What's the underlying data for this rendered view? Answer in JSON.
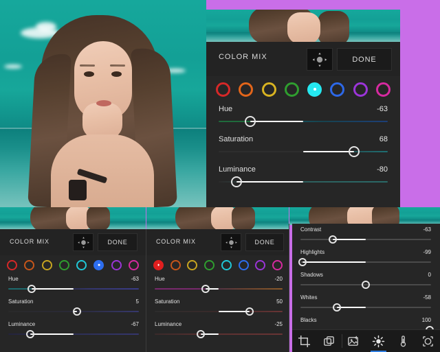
{
  "app": {
    "background_accent": "#c96ee8",
    "panel_bg": "#262626"
  },
  "main_panel": {
    "title": "COLOR MIX",
    "target_button_label": "target-select",
    "done_label": "DONE",
    "swatches": [
      {
        "name": "red",
        "color": "#d62828",
        "selected": false
      },
      {
        "name": "orange",
        "color": "#e2651a",
        "selected": false
      },
      {
        "name": "yellow",
        "color": "#d8b321",
        "selected": false
      },
      {
        "name": "green",
        "color": "#2f9e2f",
        "selected": false
      },
      {
        "name": "aqua",
        "color": "#25e8f0",
        "selected": true
      },
      {
        "name": "blue",
        "color": "#2d68e8",
        "selected": false
      },
      {
        "name": "purple",
        "color": "#9b35d8",
        "selected": false
      },
      {
        "name": "magenta",
        "color": "#d62aa0",
        "selected": false
      }
    ],
    "sliders": [
      {
        "label": "Hue",
        "value": "-63",
        "pct": 18.5,
        "track": "linear-gradient(90deg,#1f6b3c 0%, #1f6b3c 22%, #17525c 45%, #17424f 62%, #1d3f78 100%)"
      },
      {
        "label": "Saturation",
        "value": "68",
        "pct": 80.0,
        "track": "linear-gradient(90deg,#2e2e2e 0%, #2e2e2e 50%, #1e6f73 100%)"
      },
      {
        "label": "Luminance",
        "value": "-80",
        "pct": 10.5,
        "track": "linear-gradient(90deg,#2b2b2b 0%, #2f5e5c 40%, #2a6a68 100%)"
      }
    ]
  },
  "bottom_left_panel": {
    "title": "COLOR MIX",
    "done_label": "DONE",
    "swatches": [
      {
        "name": "red",
        "color": "#d62828",
        "selected": false
      },
      {
        "name": "orange",
        "color": "#c7561a",
        "selected": false
      },
      {
        "name": "yellow",
        "color": "#c8a520",
        "selected": false
      },
      {
        "name": "green",
        "color": "#2f9e2f",
        "selected": false
      },
      {
        "name": "aqua",
        "color": "#20c8d8",
        "selected": false
      },
      {
        "name": "blue",
        "color": "#2d6ef0",
        "selected": true
      },
      {
        "name": "purple",
        "color": "#9b35d8",
        "selected": false
      },
      {
        "name": "magenta",
        "color": "#d62aa0",
        "selected": false
      }
    ],
    "sliders": [
      {
        "label": "Hue",
        "value": "-63",
        "pct": 18.0,
        "track": "linear-gradient(90deg,#1d6a6e 0%, #1d6a6e 14%, #2a2a3a 38%, #34366e 62%, #3a3c88 100%)"
      },
      {
        "label": "Saturation",
        "value": "5",
        "pct": 52.5,
        "track": "linear-gradient(90deg,#2a2a2a 0%, #2a2a38 50%, #36386e 100%)"
      },
      {
        "label": "Luminance",
        "value": "-67",
        "pct": 17.0,
        "track": "linear-gradient(90deg,#24243c 0%, #2c2e52 45%, #34366e 100%)"
      }
    ]
  },
  "bottom_middle_panel": {
    "title": "COLOR MIX",
    "done_label": "DONE",
    "swatches": [
      {
        "name": "red",
        "color": "#e01f1f",
        "selected": true
      },
      {
        "name": "orange",
        "color": "#c7561a",
        "selected": false
      },
      {
        "name": "yellow",
        "color": "#c8a520",
        "selected": false
      },
      {
        "name": "green",
        "color": "#2f9e2f",
        "selected": false
      },
      {
        "name": "aqua",
        "color": "#20c8d8",
        "selected": false
      },
      {
        "name": "blue",
        "color": "#2d6ef0",
        "selected": false
      },
      {
        "name": "purple",
        "color": "#9b35d8",
        "selected": false
      },
      {
        "name": "magenta",
        "color": "#d62aa0",
        "selected": false
      }
    ],
    "sliders": [
      {
        "label": "Hue",
        "value": "-20",
        "pct": 40.0,
        "track": "linear-gradient(90deg,#7a2a6e 0%, #7a2a6e 34%, #50304a 46%, #6b4330 70%, #8a5a2a 100%)"
      },
      {
        "label": "Saturation",
        "value": "50",
        "pct": 74.0,
        "track": "linear-gradient(90deg,#2d2d2d 0%, #3a2a2a 50%, #6a3434 100%)"
      },
      {
        "label": "Luminance",
        "value": "-25",
        "pct": 36.0,
        "track": "linear-gradient(90deg,#3a2a2a 0%, #5a3030 40%, #6a3434 100%)"
      }
    ]
  },
  "bottom_right_panel": {
    "sliders": [
      {
        "label": "Contrast",
        "value": "-63",
        "pct": 24.5
      },
      {
        "label": "Highlights",
        "value": "-99",
        "pct": 1.5
      },
      {
        "label": "Shadows",
        "value": "0",
        "pct": 50.0
      },
      {
        "label": "Whites",
        "value": "-58",
        "pct": 28.0
      },
      {
        "label": "Blacks",
        "value": "100",
        "pct": 99.0
      }
    ],
    "toolbar": [
      {
        "name": "crop-icon",
        "active": false
      },
      {
        "name": "layers-icon",
        "active": false
      },
      {
        "name": "healing-icon",
        "active": false
      },
      {
        "name": "light-icon",
        "active": true
      },
      {
        "name": "color-icon",
        "active": false
      },
      {
        "name": "effects-icon",
        "active": false
      }
    ]
  }
}
